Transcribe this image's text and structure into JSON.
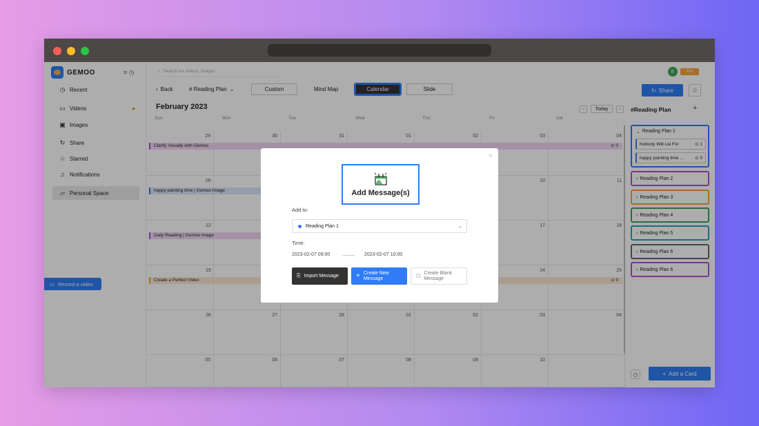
{
  "sidebar": {
    "logo_text": "GEMOO",
    "items": [
      {
        "label": "Recent",
        "icon": "clock-icon"
      },
      {
        "label": "Videos",
        "icon": "video-icon"
      },
      {
        "label": "Images",
        "icon": "image-icon"
      },
      {
        "label": "Share",
        "icon": "share-icon"
      },
      {
        "label": "Starred",
        "icon": "star-icon"
      },
      {
        "label": "Notifications",
        "icon": "bell-icon"
      },
      {
        "label": "Personal Space",
        "icon": "folder-icon"
      }
    ],
    "record_label": "Record a video"
  },
  "search": {
    "placeholder": "Search for videos, images"
  },
  "toolbar": {
    "back_label": "Back",
    "plan_label": "# Reading Plan",
    "tabs": [
      "Custom",
      "Mind Map",
      "Calendar",
      "Slide"
    ],
    "active_tab": "Calendar"
  },
  "calendar": {
    "month": "February 2023",
    "today_label": "Today",
    "weekdays": [
      "Sun",
      "Mon",
      "Tue",
      "Wed",
      "Thu",
      "Fri",
      "Sat"
    ],
    "weeks": [
      [
        "29",
        "30",
        "31",
        "01",
        "02",
        "03",
        "04"
      ],
      [
        "05",
        "",
        "",
        "",
        "",
        "10",
        "11"
      ],
      [
        "12",
        "",
        "",
        "",
        "",
        "17",
        "18"
      ],
      [
        "19",
        "",
        "",
        "",
        "",
        "24",
        "25"
      ],
      [
        "26",
        "27",
        "28",
        "01",
        "02",
        "03",
        "04"
      ],
      [
        "05",
        "06",
        "07",
        "08",
        "09",
        "10",
        ""
      ]
    ],
    "events": [
      {
        "label": "Clarify Visually with Gemoo",
        "count": "0"
      },
      {
        "label": "happy painting time | Gemoo Image"
      },
      {
        "label": "Daily Reading | Gemoo Image"
      },
      {
        "label": "Create a Perfect Video",
        "count": "0"
      }
    ]
  },
  "right_panel": {
    "avatar_initial": "E",
    "pro_label": "Pro",
    "share_label": "Share",
    "title": "#Reading Plan",
    "plans": [
      {
        "label": "Reading Plan 1",
        "color": "#2f7cf6",
        "expanded": true
      },
      {
        "label": "Reading Plan 2",
        "color": "#b04fd8"
      },
      {
        "label": "Reading Plan 3",
        "color": "#f2a43a"
      },
      {
        "label": "Reading Plan 4",
        "color": "#3aa357"
      },
      {
        "label": "Reading Plan 5",
        "color": "#26a3b8"
      },
      {
        "label": "Reading Plan 6",
        "color": "#666666"
      },
      {
        "label": "Reading Plan 6",
        "color": "#b04fd8"
      }
    ],
    "cards": [
      {
        "label": "Nobody Will Lie For",
        "count": "1"
      },
      {
        "label": "happy painting time ...",
        "count": "0"
      }
    ],
    "add_card_label": "Add a Card"
  },
  "modal": {
    "title": "Add Message(s)",
    "add_to_label": "Add to:",
    "selected_plan": "Reading Plan 1",
    "time_label": "Time:",
    "start_time": "2023-02-07 09:00",
    "end_time": "2023-02-07 10:00",
    "import_label": "Import Message",
    "create_new_label": "Create New Message",
    "create_blank_label": "Create Blank Message"
  }
}
